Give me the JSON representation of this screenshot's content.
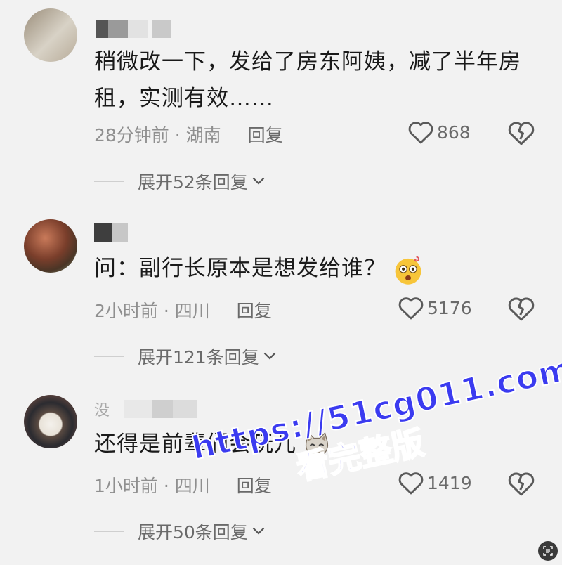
{
  "comments": [
    {
      "name": "",
      "text": "稍微改一下，发给了房东阿姨，减了半年房租，实测有效……",
      "time_loc": "28分钟前 · 湖南",
      "reply_label": "回复",
      "likes": "868",
      "expand_label": "展开52条回复"
    },
    {
      "name": "",
      "text": "问：副行长原本是想发给谁？",
      "time_loc": "2小时前 · 四川",
      "reply_label": "回复",
      "likes": "5176",
      "expand_label": "展开121条回复"
    },
    {
      "name": "没",
      "text": "还得是前辈们会玩儿",
      "time_loc": "1小时前 · 四川",
      "reply_label": "回复",
      "likes": "1419",
      "expand_label": "展开50条回复"
    }
  ],
  "watermark": {
    "url": "https://51cg011.com",
    "sub": "看完整版"
  },
  "icons": {
    "like": "heart-outline-icon",
    "dislike": "broken-heart-icon",
    "expand": "chevron-down-icon"
  },
  "colors": {
    "background": "#f2f2f2",
    "watermark": "#3b3bf0"
  }
}
